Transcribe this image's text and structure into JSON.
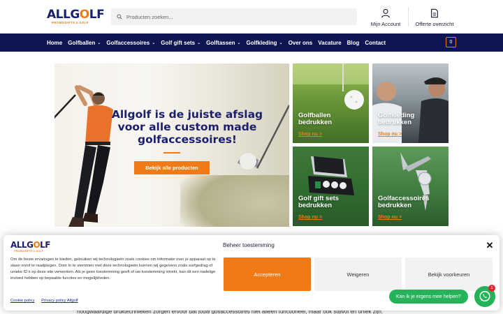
{
  "brand": {
    "logo_prefix": "ALLG",
    "logo_o": "O",
    "logo_suffix": "LF",
    "logo_tagline": "PROMOGIFTS 4 GOLF",
    "accent_color": "#f07b16",
    "navy_color": "#0e1652"
  },
  "header": {
    "search_placeholder": "Producten zoeken...",
    "account_label": "Mijn Account",
    "quote_label": "Offerte overzicht"
  },
  "nav": {
    "items": [
      {
        "label": "Home",
        "has_dropdown": false
      },
      {
        "label": "Golfballen",
        "has_dropdown": true
      },
      {
        "label": "Golfaccessoires",
        "has_dropdown": true
      },
      {
        "label": "Golf gift sets",
        "has_dropdown": true
      },
      {
        "label": "Golftassen",
        "has_dropdown": true
      },
      {
        "label": "Golfkleding",
        "has_dropdown": true
      },
      {
        "label": "Over ons",
        "has_dropdown": false
      },
      {
        "label": "Vacature",
        "has_dropdown": false
      },
      {
        "label": "Blog",
        "has_dropdown": false
      },
      {
        "label": "Contact",
        "has_dropdown": false
      }
    ],
    "cart_count": "0"
  },
  "hero": {
    "title_line1": "Allgolf is de juiste afslag",
    "title_line2": "voor alle custom made",
    "title_line3": "golfaccessoires!",
    "button_label": "Bekijk alle producten"
  },
  "tiles": [
    {
      "title_line1": "Golfballen",
      "title_line2": "bedrukken",
      "link": "Shop nu >"
    },
    {
      "title_line1": "Golfkleding",
      "title_line2": "bedrukken",
      "link": "Shop nu >"
    },
    {
      "title_line1": "Golf gift sets",
      "title_line2": "bedrukken",
      "link": "Shop nu >"
    },
    {
      "title_line1": "Golfaccessoires",
      "title_line2": "bedrukken",
      "link": "Shop nu >"
    }
  ],
  "cookie": {
    "title": "Beheer toestemming",
    "body": "Om de beste ervaringen te bieden, gebruiken wij technologieën zoals cookies om informatie over je apparaat op te slaan en/of te raadplegen. Door in te stemmen met deze technologieën kunnen wij gegevens zoals surfgedrag of unieke ID's op deze site verwerken. Als je geen toestemming geeft of uw toestemming intrekt, kan dit een nadelige invloed hebben op bepaalde functies en mogelijkheden.",
    "accept_label": "Accepteren",
    "deny_label": "Weigeren",
    "prefs_label": "Bekijk voorkeuren",
    "cookie_policy_link": "Cookie policy",
    "privacy_policy_link": "Privacy policy Allgolf"
  },
  "below_text": "hoogwaardige druktechnieken zorgen ervoor dat jouw golfaccessoires niet alleen functioneel, maar ook stijlvol en uniek zijn.",
  "chat": {
    "bubble_label": "Kan ik je ergens mee helpen?",
    "badge_count": "1"
  }
}
